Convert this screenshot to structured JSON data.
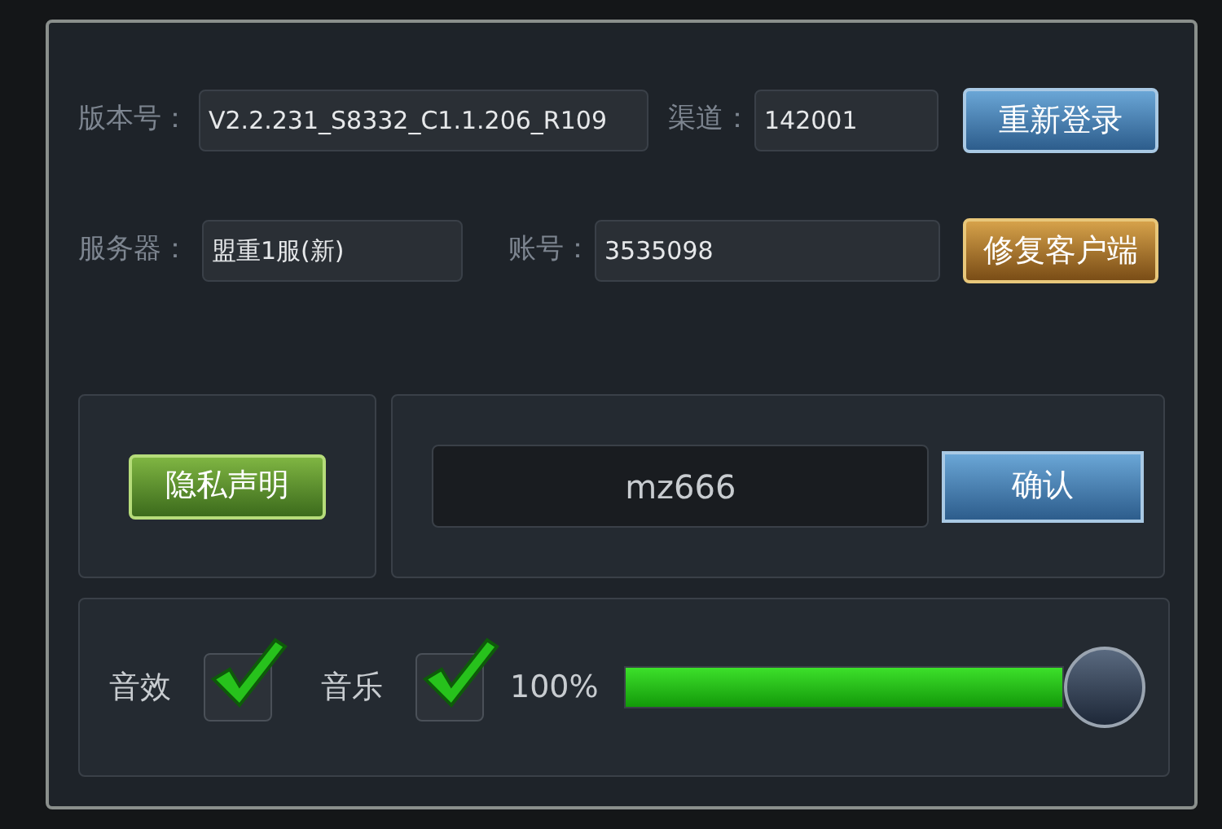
{
  "info_rows": [
    {
      "fields": [
        {
          "label": "版本号：",
          "value": "V2.2.231_S8332_C1.1.206_R109"
        },
        {
          "label": "渠道：",
          "value": "142001"
        }
      ],
      "button": {
        "label": "重新登录",
        "kind": "blue"
      }
    },
    {
      "fields": [
        {
          "label": "服务器：",
          "value": "盟重1服(新)"
        },
        {
          "label": "账号：",
          "value": "3535098"
        }
      ],
      "button": {
        "label": "修复客户端",
        "kind": "gold"
      }
    }
  ],
  "privacy_button": {
    "label": "隐私声明"
  },
  "code_input": {
    "value": "mz666"
  },
  "confirm_button": {
    "label": "确认"
  },
  "toggles": [
    {
      "label": "音效",
      "checked": true
    },
    {
      "label": "音乐",
      "checked": true
    }
  ],
  "volume": {
    "reading": "100%",
    "level": 1.0
  }
}
